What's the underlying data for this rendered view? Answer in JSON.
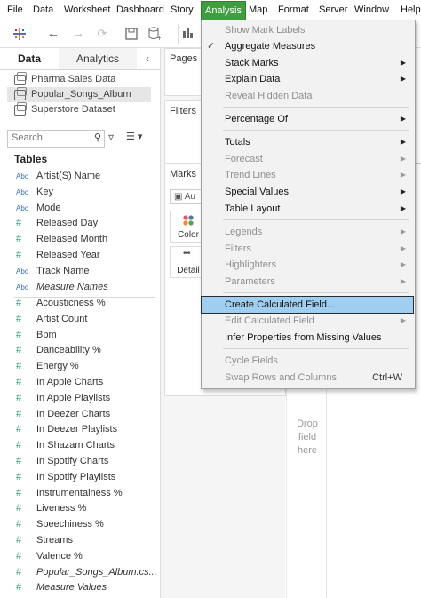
{
  "menubar": {
    "items": [
      "File",
      "Data",
      "Worksheet",
      "Dashboard",
      "Story",
      "Analysis",
      "Map",
      "Format",
      "Server",
      "Window",
      "Help"
    ],
    "active": "Analysis"
  },
  "left_tabs": {
    "data": "Data",
    "analytics": "Analytics"
  },
  "datasources": [
    "Pharma Sales Data",
    "Popular_Songs_Album",
    "Superstore Dataset"
  ],
  "search": {
    "placeholder": "Search"
  },
  "tables_heading": "Tables",
  "dimensions": [
    {
      "type": "Abc",
      "name": "Artist(S) Name"
    },
    {
      "type": "Abc",
      "name": "Key"
    },
    {
      "type": "Abc",
      "name": "Mode"
    },
    {
      "type": "#",
      "name": "Released Day"
    },
    {
      "type": "#",
      "name": "Released Month"
    },
    {
      "type": "#",
      "name": "Released Year"
    },
    {
      "type": "Abc",
      "name": "Track Name"
    },
    {
      "type": "Abc",
      "name": "Measure Names"
    }
  ],
  "measures": [
    "Acousticness %",
    "Artist Count",
    "Bpm",
    "Danceability %",
    "Energy %",
    "In Apple Charts",
    "In Apple Playlists",
    "In Deezer Charts",
    "In Deezer Playlists",
    "In Shazam Charts",
    "In Spotify Charts",
    "In Spotify Playlists",
    "Instrumentalness %",
    "Liveness %",
    "Speechiness %",
    "Streams",
    "Valence %",
    "Popular_Songs_Album.cs...",
    "Measure Values"
  ],
  "shelves": {
    "pages": "Pages",
    "filters": "Filters",
    "marks": "Marks",
    "mark_type": "Au",
    "color": "Color",
    "detail": "Detail"
  },
  "drop_hint": [
    "Drop",
    "field",
    "here"
  ],
  "analysis_menu": {
    "show_mark_labels": "Show Mark Labels",
    "aggregate_measures": "Aggregate Measures",
    "stack_marks": "Stack Marks",
    "explain_data": "Explain Data",
    "reveal_hidden_data": "Reveal Hidden Data",
    "percentage_of": "Percentage Of",
    "totals": "Totals",
    "forecast": "Forecast",
    "trend_lines": "Trend Lines",
    "special_values": "Special Values",
    "table_layout": "Table Layout",
    "legends": "Legends",
    "filters": "Filters",
    "highlighters": "Highlighters",
    "parameters": "Parameters",
    "create_calculated_field": "Create Calculated Field...",
    "edit_calculated_field": "Edit Calculated Field",
    "infer_properties": "Infer Properties from Missing Values",
    "cycle_fields": "Cycle Fields",
    "swap_rows_columns": "Swap Rows and Columns",
    "swap_shortcut": "Ctrl+W"
  },
  "colors": {
    "active_menu": "#3f9e3f",
    "highlight": "#9fcef0"
  }
}
